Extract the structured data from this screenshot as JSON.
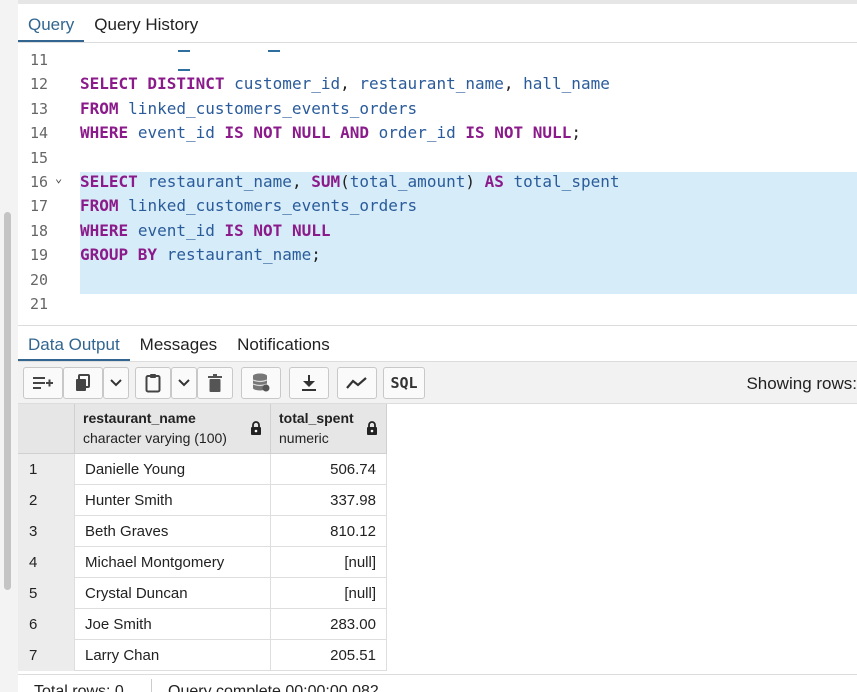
{
  "tabs": {
    "query": "Query",
    "history": "Query History"
  },
  "editor": {
    "lines": [
      {
        "num": "11",
        "tokens": []
      },
      {
        "num": "12",
        "tokens": [
          [
            "kw",
            "SELECT DISTINCT"
          ],
          [
            "pn",
            " "
          ],
          [
            "id",
            "customer_id"
          ],
          [
            "pn",
            ", "
          ],
          [
            "id",
            "restaurant_name"
          ],
          [
            "pn",
            ", "
          ],
          [
            "id",
            "hall_name"
          ]
        ]
      },
      {
        "num": "13",
        "tokens": [
          [
            "kw",
            "FROM"
          ],
          [
            "pn",
            " "
          ],
          [
            "id",
            "linked_customers_events_orders"
          ]
        ]
      },
      {
        "num": "14",
        "tokens": [
          [
            "kw",
            "WHERE"
          ],
          [
            "pn",
            " "
          ],
          [
            "id",
            "event_id"
          ],
          [
            "pn",
            " "
          ],
          [
            "kw",
            "IS NOT NULL AND"
          ],
          [
            "pn",
            " "
          ],
          [
            "id",
            "order_id"
          ],
          [
            "pn",
            " "
          ],
          [
            "kw",
            "IS NOT NULL"
          ],
          [
            "pn",
            ";"
          ]
        ]
      },
      {
        "num": "15",
        "tokens": []
      },
      {
        "num": "16",
        "tokens": [
          [
            "kw",
            "SELECT"
          ],
          [
            "pn",
            " "
          ],
          [
            "id",
            "restaurant_name"
          ],
          [
            "pn",
            ", "
          ],
          [
            "kw",
            "SUM"
          ],
          [
            "pn",
            "("
          ],
          [
            "id",
            "total_amount"
          ],
          [
            "pn",
            ") "
          ],
          [
            "kw",
            "AS"
          ],
          [
            "pn",
            " "
          ],
          [
            "id",
            "total_spent"
          ]
        ]
      },
      {
        "num": "17",
        "tokens": [
          [
            "kw",
            "FROM"
          ],
          [
            "pn",
            " "
          ],
          [
            "id",
            "linked_customers_events_orders"
          ]
        ]
      },
      {
        "num": "18",
        "tokens": [
          [
            "kw",
            "WHERE"
          ],
          [
            "pn",
            " "
          ],
          [
            "id",
            "event_id"
          ],
          [
            "pn",
            " "
          ],
          [
            "kw",
            "IS NOT NULL"
          ]
        ]
      },
      {
        "num": "19",
        "tokens": [
          [
            "kw",
            "GROUP BY"
          ],
          [
            "pn",
            " "
          ],
          [
            "id",
            "restaurant_name"
          ],
          [
            "pn",
            ";"
          ]
        ]
      },
      {
        "num": "20",
        "tokens": []
      },
      {
        "num": "21",
        "tokens": []
      }
    ]
  },
  "output_tabs": {
    "data_output": "Data Output",
    "messages": "Messages",
    "notifications": "Notifications"
  },
  "toolbar": {
    "sql_label": "SQL",
    "showing_rows": "Showing rows:"
  },
  "grid": {
    "columns": [
      {
        "name": "restaurant_name",
        "type": "character varying (100)"
      },
      {
        "name": "total_spent",
        "type": "numeric"
      }
    ],
    "rows": [
      {
        "n": "1",
        "name": "Danielle Young",
        "total": "506.74"
      },
      {
        "n": "2",
        "name": "Hunter Smith",
        "total": "337.98"
      },
      {
        "n": "3",
        "name": "Beth Graves",
        "total": "810.12"
      },
      {
        "n": "4",
        "name": "Michael Montgomery",
        "total": "[null]"
      },
      {
        "n": "5",
        "name": "Crystal Duncan",
        "total": "[null]"
      },
      {
        "n": "6",
        "name": "Joe Smith",
        "total": "283.00"
      },
      {
        "n": "7",
        "name": "Larry Chan",
        "total": "205.51"
      }
    ]
  },
  "status": {
    "total_rows": "Total rows: 0",
    "query_complete": "Query complete 00:00:00.082"
  },
  "colors": {
    "accent": "#326690",
    "keyword": "#8b1a8b",
    "identifier": "#2a5b9a",
    "selection": "#d6ecf8"
  }
}
